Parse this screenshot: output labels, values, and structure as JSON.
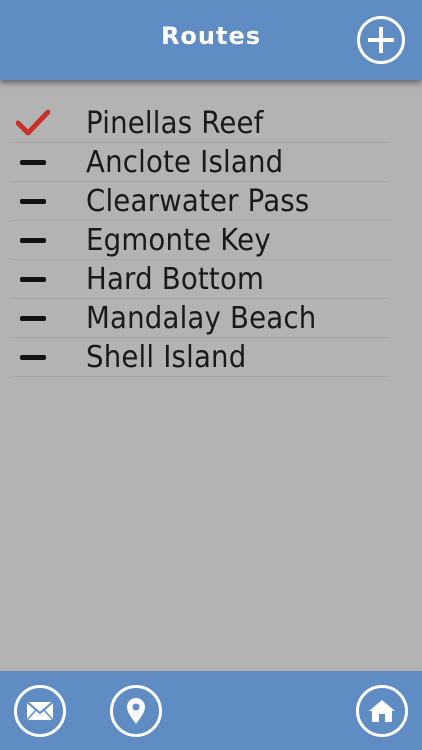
{
  "header": {
    "title": "Routes",
    "add_icon": "plus-circle-icon"
  },
  "routes": [
    {
      "name": "Pinellas Reef",
      "status": "check",
      "icon": "check-icon"
    },
    {
      "name": "Anclote Island",
      "status": "dash",
      "icon": "dash-icon"
    },
    {
      "name": "Clearwater Pass",
      "status": "dash",
      "icon": "dash-icon"
    },
    {
      "name": "Egmonte Key",
      "status": "dash",
      "icon": "dash-icon"
    },
    {
      "name": "Hard Bottom",
      "status": "dash",
      "icon": "dash-icon"
    },
    {
      "name": "Mandalay Beach",
      "status": "dash",
      "icon": "dash-icon"
    },
    {
      "name": "Shell Island",
      "status": "dash",
      "icon": "dash-icon"
    }
  ],
  "footer": {
    "icons": [
      "mail-icon",
      "location-pin-icon",
      "home-icon"
    ]
  },
  "colors": {
    "bar": "#5f8cc2",
    "background": "#b3b3b3",
    "check": "#c8312a",
    "text": "#1a1a1a"
  }
}
